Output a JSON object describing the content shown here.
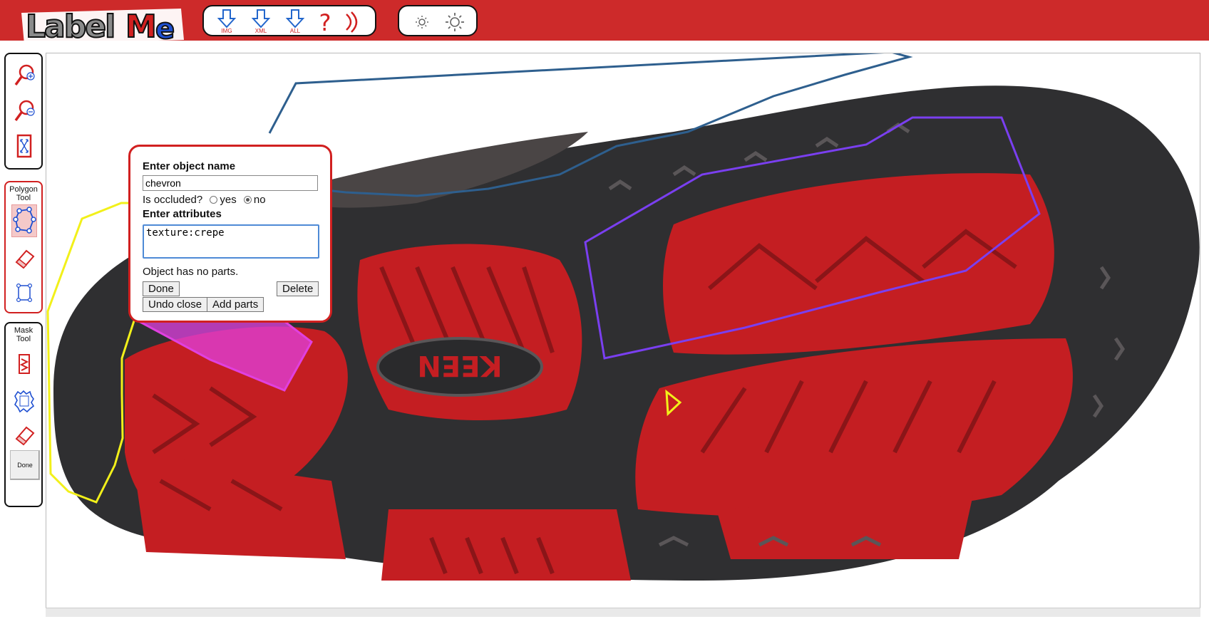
{
  "app": {
    "logo_text": "LabelMe",
    "toolbar": {
      "download_img_label": "IMG",
      "download_xml_label": "XML",
      "download_all_label": "ALL",
      "help_icon": "question-mark-icon",
      "signal_icon": "signal-waves-icon",
      "brightness_low_icon": "sun-small-icon",
      "brightness_high_icon": "sun-large-icon"
    },
    "side_tools": {
      "polygon_title": "Polygon Tool",
      "mask_title": "Mask Tool",
      "done_label": "Done"
    }
  },
  "popup": {
    "name_heading": "Enter object name",
    "name_value": "chevron",
    "occluded_label": "Is occluded?",
    "occluded_options": [
      "yes",
      "no"
    ],
    "occluded_selected": "no",
    "attributes_heading": "Enter attributes",
    "attributes_value": "texture:crepe",
    "parts_text": "Object has no parts.",
    "done_label": "Done",
    "delete_label": "Delete",
    "undo_label": "Undo close",
    "add_parts_label": "Add parts"
  },
  "colors": {
    "brand_red": "#cd2a2a",
    "polygon_blue": "#2e5f8e",
    "polygon_purple": "#7a3ff0",
    "polygon_yellow": "#f2f01a",
    "polygon_magenta": "#e040e0",
    "sole_red": "#c41e22",
    "sole_dark": "#2f2f31"
  }
}
